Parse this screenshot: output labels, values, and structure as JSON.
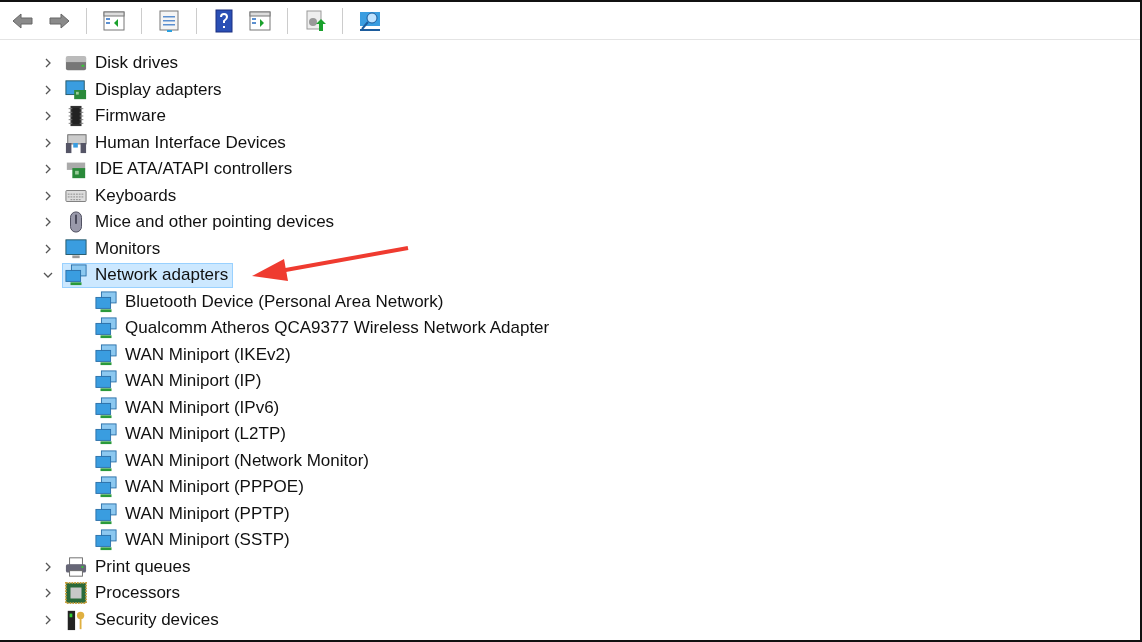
{
  "toolbar": [
    {
      "kind": "back"
    },
    {
      "kind": "forward"
    },
    {
      "kind": "sep"
    },
    {
      "kind": "tree"
    },
    {
      "kind": "sep"
    },
    {
      "kind": "properties"
    },
    {
      "kind": "sep"
    },
    {
      "kind": "help"
    },
    {
      "kind": "pane"
    },
    {
      "kind": "sep"
    },
    {
      "kind": "update"
    },
    {
      "kind": "sep"
    },
    {
      "kind": "scan"
    }
  ],
  "tree": [
    {
      "label": "Disk drives",
      "kind": "disk",
      "expanded": false,
      "selected": false
    },
    {
      "label": "Display adapters",
      "kind": "display",
      "expanded": false,
      "selected": false
    },
    {
      "label": "Firmware",
      "kind": "chip",
      "expanded": false,
      "selected": false
    },
    {
      "label": "Human Interface Devices",
      "kind": "hid",
      "expanded": false,
      "selected": false
    },
    {
      "label": "IDE ATA/ATAPI controllers",
      "kind": "ide",
      "expanded": false,
      "selected": false
    },
    {
      "label": "Keyboards",
      "kind": "keyboard",
      "expanded": false,
      "selected": false
    },
    {
      "label": "Mice and other pointing devices",
      "kind": "mouse",
      "expanded": false,
      "selected": false
    },
    {
      "label": "Monitors",
      "kind": "monitor",
      "expanded": false,
      "selected": false
    },
    {
      "label": "Network adapters",
      "kind": "network",
      "expanded": true,
      "selected": true,
      "children": [
        {
          "label": "Bluetooth Device (Personal Area Network)",
          "kind": "network",
          "selected": false
        },
        {
          "label": "Qualcomm Atheros QCA9377 Wireless Network Adapter",
          "kind": "network",
          "selected": false
        },
        {
          "label": "WAN Miniport (IKEv2)",
          "kind": "network",
          "selected": false
        },
        {
          "label": "WAN Miniport (IP)",
          "kind": "network",
          "selected": false
        },
        {
          "label": "WAN Miniport (IPv6)",
          "kind": "network",
          "selected": false
        },
        {
          "label": "WAN Miniport (L2TP)",
          "kind": "network",
          "selected": false
        },
        {
          "label": "WAN Miniport (Network Monitor)",
          "kind": "network",
          "selected": false
        },
        {
          "label": "WAN Miniport (PPPOE)",
          "kind": "network",
          "selected": false
        },
        {
          "label": "WAN Miniport (PPTP)",
          "kind": "network",
          "selected": false
        },
        {
          "label": "WAN Miniport (SSTP)",
          "kind": "network",
          "selected": false
        }
      ]
    },
    {
      "label": "Print queues",
      "kind": "printer",
      "expanded": false,
      "selected": false
    },
    {
      "label": "Processors",
      "kind": "processor",
      "expanded": false,
      "selected": false
    },
    {
      "label": "Security devices",
      "kind": "security",
      "expanded": false,
      "selected": false
    }
  ],
  "annotation": {
    "kind": "arrow"
  }
}
